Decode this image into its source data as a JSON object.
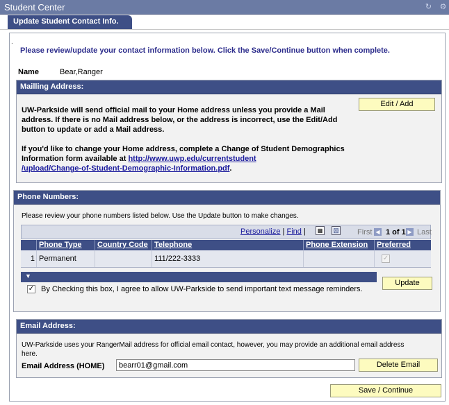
{
  "window": {
    "title": "Student Center"
  },
  "tab": {
    "label": "Update Student Contact Info."
  },
  "intro": {
    "dot": ".",
    "text": "Please review/update your contact information below. Click the Save/Continue button when complete."
  },
  "name": {
    "label": "Name",
    "value": "Bear,Ranger"
  },
  "mailing": {
    "header": "Mailling Address:",
    "para1": "UW-Parkside will send official mail to your Home address unless you provide a Mail address.  If there is no Mail address below, or the address is incorrect, use the Edit/Add button to update or add a Mail address.",
    "para2_prefix": "If you'd like to change your Home address, complete a Change of Student Demographics Information form available at",
    "link_line1": "http://www.uwp.edu/currentstudent",
    "link_line2": "/upload/Change-of-Student-Demographic-Information.pdf",
    "para2_suffix": ".",
    "edit_button": "Edit / Add"
  },
  "phone": {
    "header": "Phone Numbers:",
    "instructions": "Please review your phone numbers listed below. Use the Update button to make changes.",
    "grid_links": {
      "personalize": "Personalize",
      "sep": "|",
      "find": "Find",
      "sep2": "|"
    },
    "nav": {
      "first": "First",
      "range": "1 of 1",
      "last": "Last"
    },
    "columns": [
      "Phone Type",
      "Country Code",
      "Telephone",
      "Phone Extension",
      "Preferred"
    ],
    "rows": [
      {
        "num": "1",
        "type": "Permanent",
        "country": "",
        "telephone": "111/222-3333",
        "extension": "",
        "preferred": true
      }
    ],
    "consent_checked": true,
    "consent_text": "By Checking this box, I agree to allow UW-Parkside to send important text message reminders.",
    "update_button": "Update"
  },
  "email": {
    "header": "Email Address:",
    "instructions": "UW-Parkside uses your RangerMail address for official email contact, however, you may provide an additional email address here.",
    "label": "Email Address (HOME)",
    "value": "bearr01@gmail.com",
    "delete_button": "Delete Email"
  },
  "save_button": "Save / Continue",
  "icons": {
    "refresh": "refresh-icon",
    "settings": "gear-icon",
    "grid_view": "view-all-icon",
    "download": "spreadsheet-icon",
    "collapse": "collapse-triangle-icon"
  },
  "colors": {
    "header_bg": "#3e4f86",
    "button_bg": "#fdfbbf",
    "intro_text": "#2d2d8c",
    "link": "#1a1a9c"
  }
}
